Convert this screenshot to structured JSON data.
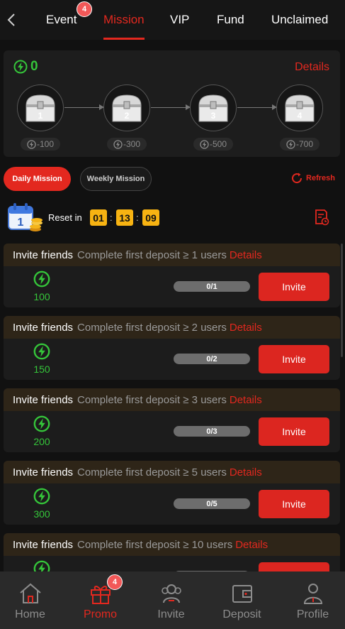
{
  "topnav": {
    "back_icon": "chevron-left-icon",
    "tabs": [
      {
        "label": "Event",
        "badge": "4"
      },
      {
        "label": "Mission",
        "active": true
      },
      {
        "label": "VIP"
      },
      {
        "label": "Fund"
      },
      {
        "label": "Unclaimed"
      }
    ]
  },
  "chest_panel": {
    "energy_total": "0",
    "details_label": "Details",
    "chests": [
      {
        "number": "1",
        "cost": "-100"
      },
      {
        "number": "2",
        "cost": "-300"
      },
      {
        "number": "3",
        "cost": "-500"
      },
      {
        "number": "4",
        "cost": "-700"
      }
    ]
  },
  "mission_tabs": {
    "daily": "Daily Mission",
    "weekly": "Weekly Mission",
    "refresh": "Refresh"
  },
  "reset": {
    "label": "Reset in",
    "hours": "01",
    "minutes": "13",
    "seconds": "09",
    "separator": ":"
  },
  "missions": [
    {
      "title": "Invite friends",
      "desc": "Complete first deposit ≥ 1 users",
      "details": "Details",
      "reward": "100",
      "progress": "0/1",
      "action": "Invite"
    },
    {
      "title": "Invite friends",
      "desc": "Complete first deposit ≥ 2 users",
      "details": "Details",
      "reward": "150",
      "progress": "0/2",
      "action": "Invite"
    },
    {
      "title": "Invite friends",
      "desc": "Complete first deposit ≥ 3 users",
      "details": "Details",
      "reward": "200",
      "progress": "0/3",
      "action": "Invite"
    },
    {
      "title": "Invite friends",
      "desc": "Complete first deposit ≥ 5 users",
      "details": "Details",
      "reward": "300",
      "progress": "0/5",
      "action": "Invite"
    },
    {
      "title": "Invite friends",
      "desc": "Complete first deposit ≥ 10 users",
      "details": "Details",
      "reward": "",
      "progress": "",
      "action": ""
    }
  ],
  "bottomnav": {
    "items": [
      {
        "label": "Home",
        "icon": "home-icon"
      },
      {
        "label": "Promo",
        "icon": "gift-icon",
        "badge": "4",
        "active": true
      },
      {
        "label": "Invite",
        "icon": "users-icon"
      },
      {
        "label": "Deposit",
        "icon": "wallet-icon"
      },
      {
        "label": "Profile",
        "icon": "person-icon"
      }
    ]
  },
  "colors": {
    "accent_red": "#e3281f",
    "energy_green": "#35c53a",
    "timer_yellow": "#f7b312",
    "badge_red": "#f25858"
  }
}
